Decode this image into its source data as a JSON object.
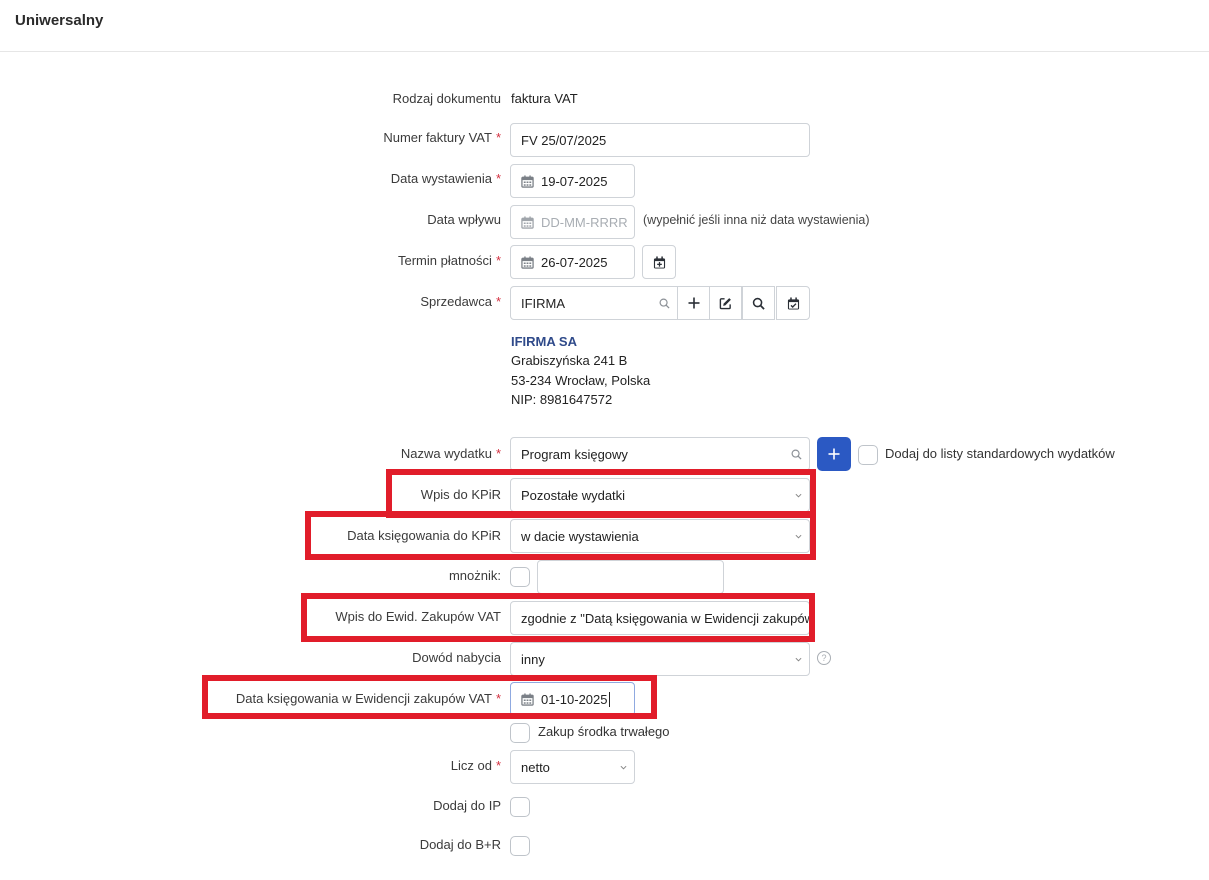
{
  "header": {
    "title": "Uniwersalny"
  },
  "form": {
    "rodzaj": {
      "label": "Rodzaj dokumentu",
      "value": "faktura VAT"
    },
    "numer": {
      "label": "Numer faktury VAT",
      "value": "FV 25/07/2025"
    },
    "data_wyst": {
      "label": "Data wystawienia",
      "value": "19-07-2025"
    },
    "data_wplywu": {
      "label": "Data wpływu",
      "placeholder": "DD-MM-RRRR",
      "hint": "(wypełnić jeśli inna niż data wystawienia)"
    },
    "termin": {
      "label": "Termin płatności",
      "value": "26-07-2025"
    },
    "sprzedawca": {
      "label": "Sprzedawca",
      "value": "IFIRMA",
      "name": "IFIRMA SA",
      "street": "Grabiszyńska 241 B",
      "city": "53-234 Wrocław, Polska",
      "nip": "NIP: 8981647572"
    },
    "nazwa": {
      "label": "Nazwa wydatku",
      "value": "Program księgowy",
      "checkbox_label": "Dodaj do listy standardowych wydatków"
    },
    "wpis_kpir": {
      "label": "Wpis do KPiR",
      "value": "Pozostałe wydatki"
    },
    "data_ksieg_kpir": {
      "label": "Data księgowania do KPiR",
      "value": "w dacie wystawienia"
    },
    "mnoznik": {
      "label": "mnożnik:",
      "value": ""
    },
    "wpis_vat": {
      "label": "Wpis do Ewid. Zakupów VAT",
      "value": "zgodnie z \"Datą księgowania w Ewidencji zakupów VAT\""
    },
    "dowod": {
      "label": "Dowód nabycia",
      "value": "inny",
      "help": "?"
    },
    "data_ksieg_vat": {
      "label": "Data księgowania w Ewidencji zakupów VAT",
      "value": "01-10-2025"
    },
    "srodek": {
      "label": "Zakup środka trwałego"
    },
    "licz_od": {
      "label": "Licz od",
      "value": "netto"
    },
    "dodaj_ip": {
      "label": "Dodaj do IP"
    },
    "dodaj_br": {
      "label": "Dodaj do B+R"
    }
  },
  "required_mark": "*",
  "colors": {
    "accent": "#2b59c3",
    "highlight": "#e11d2a",
    "required": "#d32f3f",
    "link": "#2f4a8a"
  },
  "icons": [
    "calendar-icon",
    "calendar-add-icon",
    "search-icon",
    "plus-icon",
    "edit-icon",
    "calendar-check-icon",
    "chevron-down-icon",
    "help-icon"
  ]
}
